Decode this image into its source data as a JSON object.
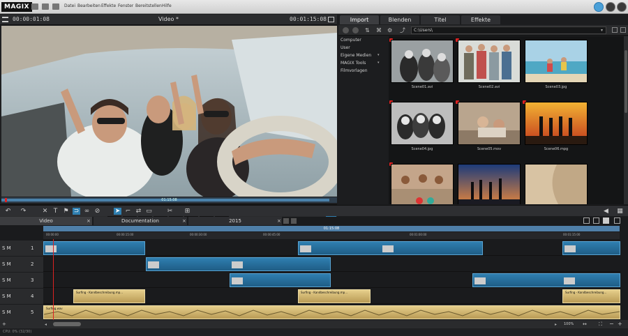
{
  "menubar": {
    "logo": "MAGIX",
    "items": [
      "Datei",
      "Bearbeiten",
      "Effekte",
      "Fenster",
      "Bereitstellen",
      "Hilfe"
    ]
  },
  "video": {
    "timecode_left": "00:00:01:08",
    "title": "Video *",
    "timecode_right": "00:01:15:08",
    "scrub_timecode": "01:15:08",
    "transport": [
      "[",
      "]",
      "⇤",
      "⏮",
      "■",
      "⏭",
      "⇥",
      "●"
    ]
  },
  "pool": {
    "tabs": [
      "Import",
      "Blenden",
      "Titel",
      "Effekte"
    ],
    "path": "C:\\Users\\",
    "nav": [
      "Computer",
      "User",
      "Eigene Medien",
      "MAGIX Tools",
      "Filmvorlagen"
    ],
    "thumbs": [
      "Scene01.avi",
      "Scene02.avi",
      "Scene03.jpg",
      "Scene04.jpg",
      "Scene05.mov",
      "Scene06.mpg",
      "",
      "",
      ""
    ]
  },
  "timeline": {
    "tabs": [
      "Video",
      "Documentation",
      "2015"
    ],
    "ruler_top": "01:15:08",
    "ruler_labels": [
      "00:00:00",
      "00:00:15:00",
      "00:00:30:00",
      "00:00:45:00",
      "00:01:00:00",
      "00:01:15:00"
    ],
    "tracks": [
      "1",
      "2",
      "3",
      "4",
      "5"
    ],
    "track_flags": "S M",
    "clips": {
      "t4a": "Surfing - Kandbeschreibung.mp...",
      "t4b": "Surfing - Kandbeschreibung.mp...",
      "t4c": "Surfing - Kandbeschreibung...",
      "t5": "Surfing.wav"
    },
    "zoom": "100%",
    "status": "CPU: 0% (32/30)"
  },
  "colors": {
    "accent": "#4aa0d8",
    "clip_blue": "#2f7fb0",
    "clip_gold": "#e6cf8c",
    "playhead": "#dd2222"
  }
}
